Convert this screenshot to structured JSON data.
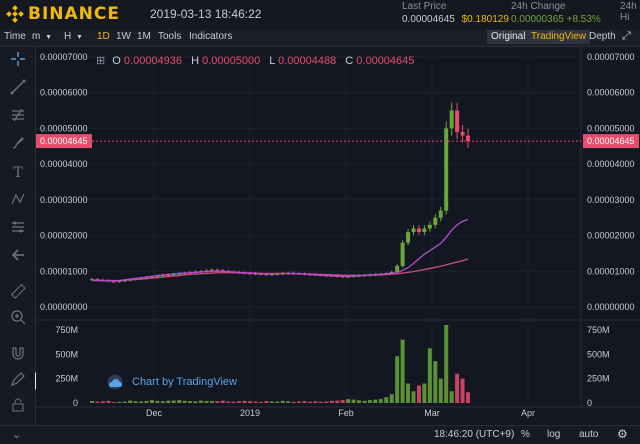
{
  "header": {
    "brand": "BINANCE",
    "datetime": "2019-03-13 18:46:22",
    "last_price_label": "Last Price",
    "last_price": "0.00004645",
    "last_price_usd": "$0.180129",
    "change_label": "24h Change",
    "change_value": "0.00000365 +8.53%",
    "high_label": "24h Hi"
  },
  "toolbar": {
    "time_label": "Time",
    "m_label": "m",
    "h_label": "H",
    "intervals": [
      "1D",
      "1W",
      "1M"
    ],
    "active_interval": "1D",
    "tools_label": "Tools",
    "indicators_label": "Indicators",
    "original_label": "Original",
    "tradingview_label": "TradingView",
    "depth_label": "Depth"
  },
  "ohlc": {
    "o_label": "O",
    "o": "0.00004936",
    "h_label": "H",
    "h": "0.00005000",
    "l_label": "L",
    "l": "0.00004488",
    "c_label": "C",
    "c": "0.00004645"
  },
  "chart_data": {
    "type": "line",
    "price_axis": [
      "0.00007000",
      "0.00006000",
      "0.00005000",
      "0.00004000",
      "0.00003000",
      "0.00002000",
      "0.00001000",
      "0.00000000"
    ],
    "price_axis_values": [
      7e-05,
      6e-05,
      5e-05,
      4e-05,
      3e-05,
      2e-05,
      1e-05,
      0.0
    ],
    "volume_axis": [
      "750M",
      "500M",
      "250M",
      "0"
    ],
    "x_ticks": [
      "Dec",
      "2019",
      "Feb",
      "Mar",
      "Apr"
    ],
    "current_price_label": "0.00004645",
    "current_price": 4.645e-05,
    "price_ylim": [
      0,
      7e-05
    ],
    "volume_ylim": [
      0,
      800000000
    ],
    "colors": {
      "up": "#6ca63a",
      "down": "#e84c6c",
      "ma_short": "#b34bd6",
      "ma_long": "#d04c7c",
      "price_line": "#e84c6c"
    },
    "price_series": [
      7.8e-06,
      7.6e-06,
      7.5e-06,
      7.2e-06,
      7.1e-06,
      7.3e-06,
      7.5e-06,
      7.7e-06,
      7.9e-06,
      8.1e-06,
      8.3e-06,
      8.5e-06,
      8.7e-06,
      8.9e-06,
      9e-06,
      9.2e-06,
      9.4e-06,
      9.5e-06,
      9.7e-06,
      9.9e-06,
      1e-05,
      1.02e-05,
      1.04e-05,
      1.03e-05,
      1.01e-05,
      9.9e-06,
      9.7e-06,
      9.6e-06,
      9.5e-06,
      9.4e-06,
      9.3e-06,
      9.2e-06,
      9.1e-06,
      9.2e-06,
      9.3e-06,
      9.4e-06,
      9.5e-06,
      9.4e-06,
      9.3e-06,
      9.2e-06,
      9.1e-06,
      9e-06,
      8.9e-06,
      8.8e-06,
      8.7e-06,
      8.6e-06,
      8.5e-06,
      8.6e-06,
      8.7e-06,
      8.8e-06,
      8.9e-06,
      9e-06,
      9.1e-06,
      9.2e-06,
      9.4e-06,
      9.8e-06,
      1.15e-05,
      1.8e-05,
      2.1e-05,
      2.2e-05,
      2.1e-05,
      2.2e-05,
      2.3e-05,
      2.5e-05,
      2.7e-05,
      5e-05,
      5.5e-05,
      4.9e-05,
      4.8e-05,
      4.65e-05
    ],
    "ma_short_series": [
      7.5e-06,
      7.5e-06,
      7.4e-06,
      7.3e-06,
      7.3e-06,
      7.4e-06,
      7.6e-06,
      7.8e-06,
      8e-06,
      8.2e-06,
      8.4e-06,
      8.6e-06,
      8.8e-06,
      9e-06,
      9.1e-06,
      9.3e-06,
      9.4e-06,
      9.5e-06,
      9.6e-06,
      9.7e-06,
      9.8e-06,
      9.9e-06,
      1e-05,
      1e-05,
      1e-05,
      9.9e-06,
      9.8e-06,
      9.7e-06,
      9.6e-06,
      9.5e-06,
      9.4e-06,
      9.3e-06,
      9.3e-06,
      9.3e-06,
      9.3e-06,
      9.4e-06,
      9.4e-06,
      9.4e-06,
      9.3e-06,
      9.2e-06,
      9.1e-06,
      9e-06,
      8.9e-06,
      8.8e-06,
      8.8e-06,
      8.7e-06,
      8.7e-06,
      8.7e-06,
      8.7e-06,
      8.8e-06,
      8.9e-06,
      9e-06,
      9.1e-06,
      9.2e-06,
      9.3e-06,
      9.4e-06,
      9.6e-06,
      1.03e-05,
      1.1e-05,
      1.22e-05,
      1.35e-05,
      1.48e-05,
      1.58e-05,
      1.68e-05,
      1.78e-05,
      1.95e-05,
      2.15e-05,
      2.3e-05,
      2.4e-05,
      2.45e-05
    ],
    "ma_long_series": [
      7.4e-06,
      7.4e-06,
      7.4e-06,
      7.4e-06,
      7.4e-06,
      7.4e-06,
      7.5e-06,
      7.6e-06,
      7.7e-06,
      7.8e-06,
      7.9e-06,
      8.1e-06,
      8.2e-06,
      8.4e-06,
      8.5e-06,
      8.7e-06,
      8.8e-06,
      9e-06,
      9.1e-06,
      9.2e-06,
      9.3e-06,
      9.4e-06,
      9.5e-06,
      9.6e-06,
      9.6e-06,
      9.6e-06,
      9.6e-06,
      9.6e-06,
      9.5e-06,
      9.5e-06,
      9.5e-06,
      9.4e-06,
      9.4e-06,
      9.4e-06,
      9.4e-06,
      9.4e-06,
      9.4e-06,
      9.3e-06,
      9.3e-06,
      9.3e-06,
      9.2e-06,
      9.2e-06,
      9.1e-06,
      9.1e-06,
      9e-06,
      9e-06,
      8.9e-06,
      8.9e-06,
      8.9e-06,
      8.9e-06,
      8.9e-06,
      8.9e-06,
      9e-06,
      9e-06,
      9.1e-06,
      9.2e-06,
      9.3e-06,
      9.5e-06,
      9.7e-06,
      9.9e-06,
      1.02e-05,
      1.05e-05,
      1.08e-05,
      1.11e-05,
      1.14e-05,
      1.18e-05,
      1.22e-05,
      1.26e-05,
      1.3e-05,
      1.34e-05
    ],
    "volume_series": [
      20,
      15,
      18,
      22,
      10,
      12,
      14,
      25,
      18,
      16,
      20,
      30,
      22,
      18,
      24,
      26,
      30,
      22,
      20,
      18,
      25,
      22,
      20,
      18,
      24,
      16,
      14,
      20,
      22,
      18,
      15,
      12,
      20,
      16,
      14,
      22,
      18,
      12,
      16,
      20,
      14,
      18,
      12,
      16,
      22,
      25,
      30,
      40,
      35,
      28,
      22,
      30,
      35,
      40,
      60,
      90,
      480,
      650,
      200,
      120,
      180,
      200,
      560,
      430,
      250,
      800,
      120,
      300,
      250,
      110
    ]
  },
  "footer": {
    "time": "18:46:20 (UTC+9)",
    "pct_label": "%",
    "log_label": "log",
    "auto_label": "auto"
  },
  "watermark": "Chart by TradingView"
}
